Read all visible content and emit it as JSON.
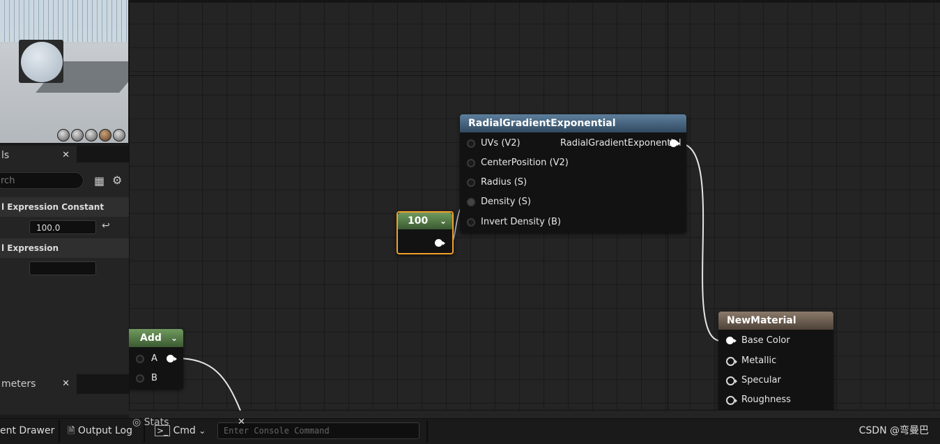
{
  "viewport": {
    "preview_buttons": [
      "cylinder-icon",
      "sphere-icon",
      "plane-icon",
      "cube-icon",
      "teapot-icon"
    ]
  },
  "details_panel": {
    "tab_label": "ls",
    "search_placeholder": "rch",
    "section1": "l Expression Constant",
    "value": "100.0",
    "section2": "l Expression",
    "desc_value": ""
  },
  "parameters_panel": {
    "tab_label": "meters",
    "hint": "                        "
  },
  "graph": {
    "radial_node": {
      "title": "RadialGradientExponential",
      "inputs": [
        "UVs (V2)",
        "CenterPosition (V2)",
        "Radius (S)",
        "Density (S)",
        "Invert Density (B)"
      ],
      "output": "RadialGradientExponential"
    },
    "constant_node": {
      "value": "100"
    },
    "add_node": {
      "title": "Add",
      "inputs": [
        "A",
        "B"
      ]
    },
    "material_node": {
      "title": "NewMaterial",
      "inputs": [
        "Base Color",
        "Metallic",
        "Specular",
        "Roughness"
      ]
    }
  },
  "bottom_bar": {
    "content_drawer": "ent Drawer",
    "output_log": "Output Log",
    "cmd": "Cmd",
    "console_placeholder": "Enter Console Command",
    "stats": "Stats"
  },
  "watermark": "CSDN @弯曼巴",
  "colors": {
    "orange_selection": "#f2a12a",
    "blue_header": "#4a6a88",
    "green_header": "#567a47",
    "brown_header": "#6d5f53"
  }
}
